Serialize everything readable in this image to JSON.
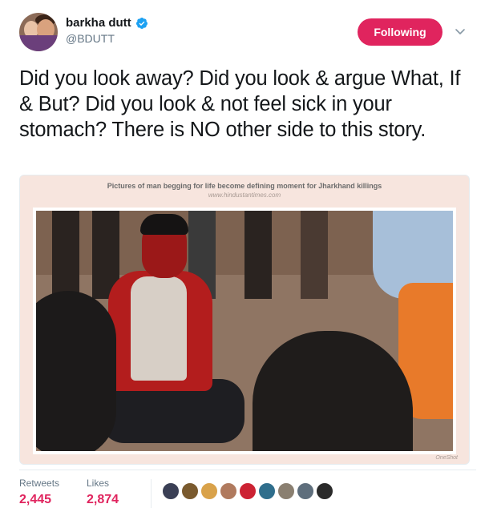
{
  "user": {
    "display_name": "barkha dutt",
    "handle": "@BDUTT",
    "verified": true,
    "avatar_icon": "avatar-photo"
  },
  "follow_button": {
    "label": "Following",
    "color": "#e0245e"
  },
  "menu": {
    "icon": "chevron-down-icon"
  },
  "tweet": {
    "text": "Did you look away? Did you look & argue What, If & But? Did you look & not feel sick in your stomach? There is NO other side to this story."
  },
  "media": {
    "caption": "Pictures of man begging for life become defining moment for Jharkhand killings",
    "source": "www.hindustantimes.com",
    "watermark": "OneShot"
  },
  "stats": {
    "retweets_label": "Retweets",
    "retweets_value": "2,445",
    "likes_label": "Likes",
    "likes_value": "2,874",
    "accent": "#e0245e"
  },
  "likers": [
    {
      "color": "#3a3f55"
    },
    {
      "color": "#7a5a2e"
    },
    {
      "color": "#d9a24a"
    },
    {
      "color": "#b07a5e"
    },
    {
      "color": "#cc2233"
    },
    {
      "color": "#2f6e8c"
    },
    {
      "color": "#8a7f70"
    },
    {
      "color": "#5e6e7c"
    },
    {
      "color": "#2a2a2a"
    }
  ]
}
